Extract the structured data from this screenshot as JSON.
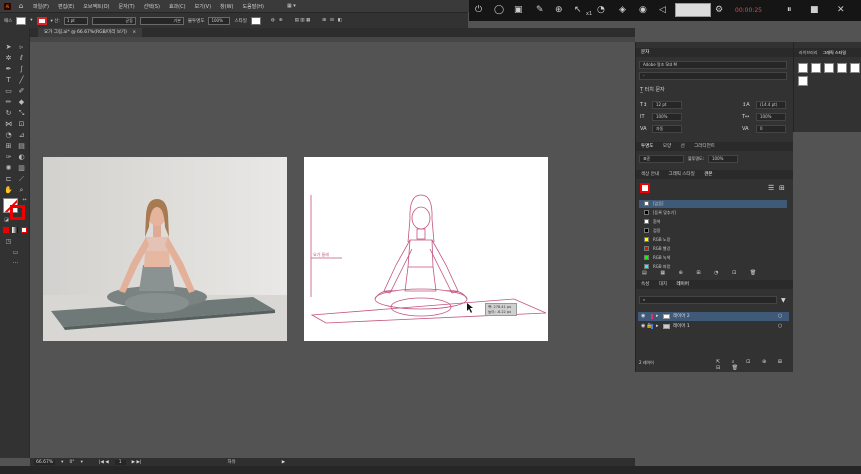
{
  "menu": {
    "logo": "Ai",
    "items": [
      "파일(F)",
      "편집(E)",
      "오브젝트(O)",
      "문자(T)",
      "선택(S)",
      "효과(C)",
      "보기(V)",
      "창(W)",
      "도움말(H)"
    ]
  },
  "control": {
    "selection_label": "패스",
    "stroke_width": "1 pt",
    "stroke_profile": "균등",
    "brush": "기본",
    "opacity_label": "불투명도",
    "opacity": "100%",
    "style_label": "스타일"
  },
  "recorder": {
    "time": "00:00:25",
    "zoom_badge": "x1"
  },
  "document": {
    "tab_title": "요가 그림.ai* @ 66.67%(RGB/미리 보기)",
    "close": "×"
  },
  "canvas": {
    "artboard2_guide_label": "요가 둘레"
  },
  "tooltip": {
    "line1": "폭: 278.41 px",
    "line2": "높이: -6.22 px"
  },
  "status": {
    "zoom": "66.67%",
    "rotation": "0°",
    "artboard_num": "1",
    "tool": "자유"
  },
  "char_panel": {
    "tab": "문자",
    "font": "Adobe 명조 Std M",
    "style": "-",
    "touch_label": "터치 문자",
    "size": "12 pt",
    "leading": "(14.4 pt)",
    "vscale": "100%",
    "hscale": "100%",
    "kerning": "자동",
    "tracking": "0",
    "aki": "0"
  },
  "mid_tabs": [
    "투명도",
    "모양",
    "선",
    "그라디언트"
  ],
  "blend": {
    "mode": "표준",
    "opacity_label": "불투명도:",
    "opacity": "100%"
  },
  "swatch_tabs": [
    "색상 안내",
    "그래픽 스타일",
    "견본"
  ],
  "swatches": [
    {
      "name": "[없음]",
      "color": "#ffffff"
    },
    {
      "name": "[등록 맞추기]",
      "color": "#000000"
    },
    {
      "name": "흰색",
      "color": "#ffffff"
    },
    {
      "name": "검정",
      "color": "#000000"
    },
    {
      "name": "RGB 노랑",
      "color": "#ffff00"
    },
    {
      "name": "RGB 빨강",
      "color": "#ff0000"
    },
    {
      "name": "RGB 녹색",
      "color": "#00ff00"
    },
    {
      "name": "RGB 파랑",
      "color": "#00ffff"
    }
  ],
  "layers_tabs": [
    "속성",
    "대지",
    "레이어"
  ],
  "layers": [
    {
      "name": "레이어 2",
      "color": "#e0336e",
      "selected": true
    },
    {
      "name": "레이어 1",
      "color": "#4a7ee0",
      "selected": false
    }
  ],
  "layers_footer": "2 레이어",
  "libraries": {
    "tabs": [
      "라이브러리",
      "그래픽 스타일"
    ]
  }
}
